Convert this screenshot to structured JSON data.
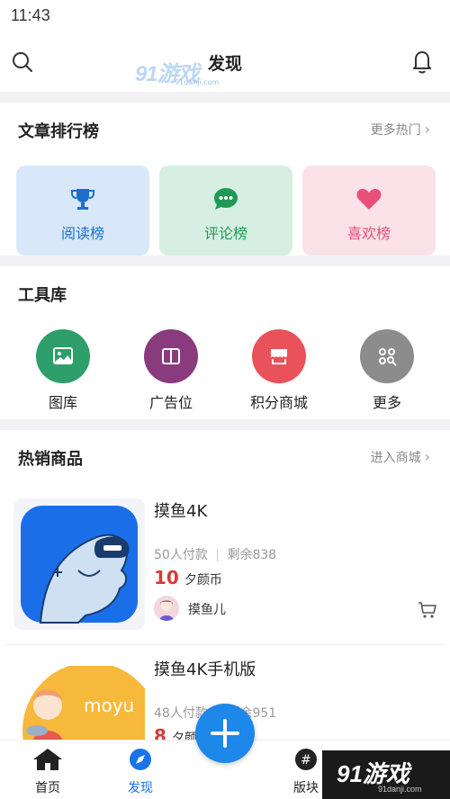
{
  "status_bar": {
    "time": "11:43"
  },
  "header": {
    "title": "发现"
  },
  "watermark": {
    "logo_text": "91游戏",
    "url": "91danji.com"
  },
  "rankings": {
    "title": "文章排行榜",
    "more": "更多热门",
    "tiles": [
      {
        "label": "阅读榜",
        "icon": "trophy-icon",
        "color": "#1c6fcf",
        "bg": "#d8e8fa"
      },
      {
        "label": "评论榜",
        "icon": "chat-bubble-icon",
        "color": "#1f9a55",
        "bg": "#d7efe2"
      },
      {
        "label": "喜欢榜",
        "icon": "heart-icon",
        "color": "#e8507a",
        "bg": "#fbe1e8"
      }
    ]
  },
  "tools": {
    "title": "工具库",
    "items": [
      {
        "label": "图库",
        "icon": "image-icon",
        "color": "#2e9e6a"
      },
      {
        "label": "广告位",
        "icon": "book-icon",
        "color": "#8a3b7e"
      },
      {
        "label": "积分商城",
        "icon": "store-icon",
        "color": "#e9525a"
      },
      {
        "label": "更多",
        "icon": "grid-search-icon",
        "color": "#8c8c8c"
      }
    ]
  },
  "hot_products": {
    "title": "热销商品",
    "more": "进入商城",
    "items": [
      {
        "name": "摸鱼4K",
        "paid": "50人付款",
        "remaining": "剩余838",
        "price": "10",
        "unit": "夕颜币",
        "seller": "摸鱼儿"
      },
      {
        "name": "摸鱼4K手机版",
        "paid": "48人付款",
        "remaining": "剩余951",
        "price": "8",
        "unit": "夕颜币",
        "thumb_text": "moyu"
      }
    ]
  },
  "tabbar": {
    "tabs": [
      {
        "label": "首页",
        "icon": "home-icon"
      },
      {
        "label": "发现",
        "icon": "compass-icon",
        "active": true
      },
      {
        "label": "版块",
        "icon": "hashtag-icon"
      }
    ]
  },
  "colors": {
    "accent": "#1d87ea",
    "price": "#d63b3b"
  }
}
